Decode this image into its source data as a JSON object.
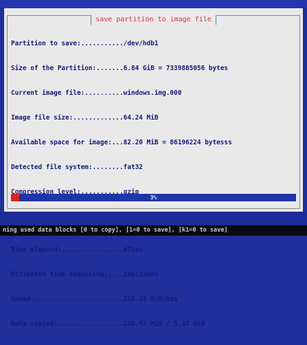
{
  "dialog": {
    "title": "save partition to image file",
    "lines": [
      "Partition to save:.........../dev/hdb1",
      "Size of the Partition:.......6.84 GiB = 7339885056 bytes",
      "Current image file:..........windows.img.000",
      "Image file size:.............64.24 MiB",
      "Available space for image:...82.20 MiB = 86196224 bytesss",
      "Detected file system:........fat32",
      "Compression level:...........gzip",
      "",
      "",
      "Time elapsed:................47sec",
      "Estimated time remaining:....24m:25sec",
      "Speed:.......................218.19 MiB/min",
      "Data copied:.................170.92 MiB / 5.37 GiB"
    ]
  },
  "progress": {
    "label": "3%",
    "fraction": 0.03
  },
  "status": {
    "text": "ning used data blocks [0 to copy], [1=0 to save], [k1=0 to save]"
  },
  "colors": {
    "background": "#1f2f9c",
    "dialog": "#e9e9e9",
    "title": "#d23a33",
    "text": "#121a7a",
    "progress_fill": "#d9261d",
    "progress_track": "#1f35a8"
  }
}
